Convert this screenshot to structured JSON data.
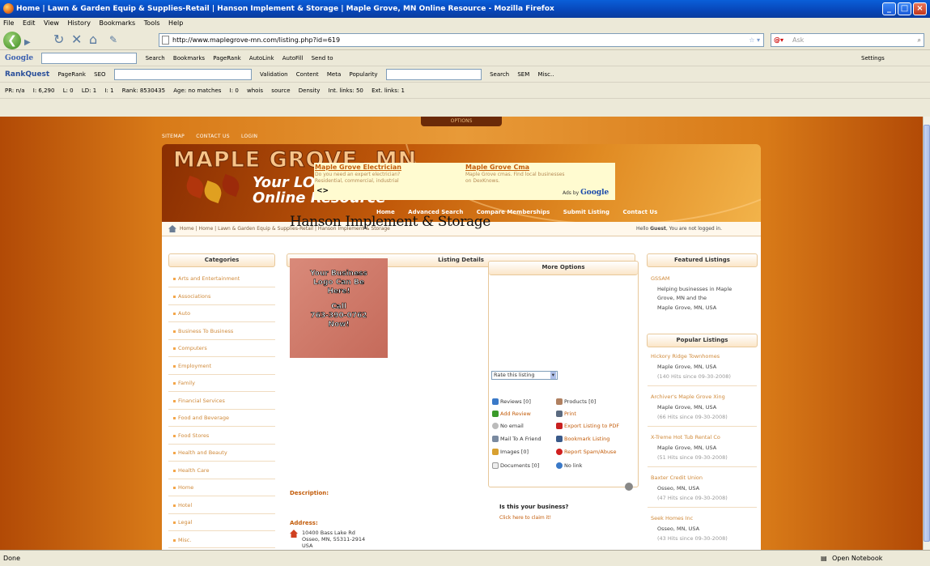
{
  "window": {
    "title": "Home | Lawn & Garden Equip & Supplies-Retail | Hanson Implement & Storage | Maple Grove, MN Online Resource - Mozilla Firefox"
  },
  "menu": [
    "File",
    "Edit",
    "View",
    "History",
    "Bookmarks",
    "Tools",
    "Help"
  ],
  "url": "http://www.maplegrove-mn.com/listing.php?id=619",
  "search_placeholder": "Ask",
  "google_toolbar": {
    "search": "Search",
    "bookmarks": "Bookmarks",
    "pagerank": "PageRank",
    "autolink": "AutoLink",
    "autofill": "AutoFill",
    "sendto": "Send to",
    "settings": "Settings"
  },
  "rankquest_toolbar": {
    "brand": "RankQuest",
    "pagerank": "PageRank",
    "seo": "SEO",
    "validation": "Validation",
    "content": "Content",
    "meta": "Meta",
    "popularity": "Popularity",
    "search": "Search",
    "sem": "SEM",
    "misc": "Misc.."
  },
  "seo_toolbar": {
    "pr": "PR: n/a",
    "i": "I: 6,290",
    "l": "L: 0",
    "ld": "LD: 1",
    "i2": "I: 1",
    "rank": "Rank: 8530435",
    "age": "Age: no matches",
    "i3": "I: 0",
    "whois": "whois",
    "source": "source",
    "density": "Density",
    "int": "Int. links: 50",
    "ext": "Ext. links: 1"
  },
  "options_tab": "OPTIONS",
  "toplinks": [
    "SITEMAP",
    "CONTACT US",
    "LOGIN"
  ],
  "banner": {
    "title": "MAPLE GROVE, MN",
    "line1": "Your LOCAL",
    "line2": "Online Resource"
  },
  "banner_nav": [
    "Home",
    "Advanced Search",
    "Compare Memberships",
    "Submit Listing",
    "Contact Us"
  ],
  "breadcrumb": "Home | Home | Lawn & Garden Equip & Supplies-Retail | Hanson Implement & Storage",
  "hello": {
    "pre": "Hello ",
    "name": "Guest",
    "post": ", You are not logged in."
  },
  "categories": {
    "title": "Categories",
    "items": [
      "Arts and Entertainment",
      "Associations",
      "Auto",
      "Business To Business",
      "Computers",
      "Employment",
      "Family",
      "Financial Services",
      "Food and Beverage",
      "Food Stores",
      "Health and Beauty",
      "Health Care",
      "Home",
      "Hotel",
      "Legal",
      "Misc."
    ]
  },
  "listing": {
    "header": "Listing Details",
    "ads": [
      {
        "title": "Maple Grove Electrician",
        "text1": "Do you need an expert electrician?",
        "text2": "Residential, commercial, industrial"
      },
      {
        "title": "Maple Grove Cma",
        "text1": "Maple Grove cmas. Find local businesses",
        "text2": "on DexKnows."
      }
    ],
    "ads_by": "Ads by",
    "ads_brand": "Google",
    "name": "Hanson Implement & Storage",
    "logo_text": [
      "Your Business",
      "Logo Can Be",
      "Here!",
      "",
      "Call",
      "763-390-0762",
      "Now!"
    ],
    "description_label": "Description:",
    "address_label": "Address:",
    "address": [
      "10400 Bass Lake Rd",
      "Osseo, MN, 55311-2914",
      "USA"
    ]
  },
  "more_options": {
    "title": "More Options",
    "left": [
      "Reviews [0]",
      "Add Review",
      "No email",
      "Mail To A Friend",
      "Images [0]",
      "Documents [0]"
    ],
    "right": [
      "Products [0]",
      "Print",
      "Export Listing to PDF",
      "Bookmark Listing",
      "Report Spam/Abuse",
      "No link"
    ],
    "rate": "Rate this listing",
    "claim_q": "Is this your business?",
    "claim_link": "Click here to claim it!"
  },
  "featured": {
    "title": "Featured Listings",
    "name": "GSSAM",
    "desc": [
      "Helping businesses in Maple",
      "Grove, MN and the"
    ],
    "loc": "Maple Grove, MN, USA"
  },
  "popular": {
    "title": "Popular Listings",
    "items": [
      {
        "name": "Hickory Ridge Townhomes",
        "loc": "Maple Grove, MN, USA",
        "hits": "(140 Hits since 09-30-2008)"
      },
      {
        "name": "Archiver's Maple Grove Xing",
        "loc": "Maple Grove, MN, USA",
        "hits": "(66 Hits since 09-30-2008)"
      },
      {
        "name": "X-Treme Hot Tub Rental Co",
        "loc": "Maple Grove, MN, USA",
        "hits": "(51 Hits since 09-30-2008)"
      },
      {
        "name": "Baxter Credit Union",
        "loc": "Osseo, MN, USA",
        "hits": "(47 Hits since 09-30-2008)"
      },
      {
        "name": "Seek Homes Inc",
        "loc": "Osseo, MN, USA",
        "hits": "(43 Hits since 09-30-2008)"
      }
    ]
  },
  "status": {
    "left": "Done",
    "notebook": "Open Notebook"
  }
}
